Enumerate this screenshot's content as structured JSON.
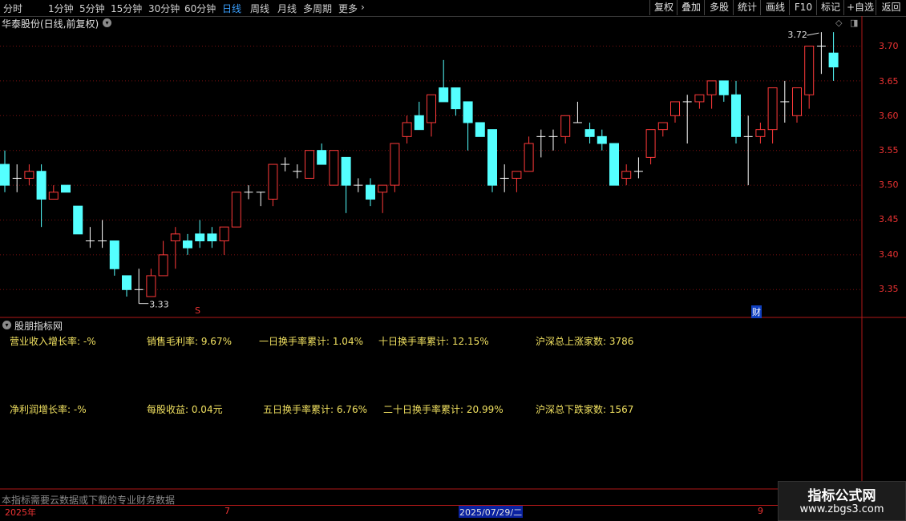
{
  "toolbar": {
    "periods": [
      "分时",
      "1分钟",
      "5分钟",
      "15分钟",
      "30分钟",
      "60分钟",
      "日线",
      "周线",
      "月线",
      "多周期",
      "更多"
    ],
    "active_period": "日线",
    "more_arrow": "›",
    "buttons": [
      "复权",
      "叠加",
      "多股",
      "统计",
      "画线",
      "F10",
      "标记",
      "+自选",
      "返回"
    ]
  },
  "chart": {
    "title": "华泰股份(日线,前复权)",
    "price_labels": [
      "3.70",
      "3.65",
      "3.60",
      "3.55",
      "3.50",
      "3.45",
      "3.40",
      "3.35"
    ],
    "high_annotation": "3.72",
    "low_annotation": "3.33",
    "marker_s": "S",
    "marker_cai": "财",
    "colors": {
      "up": "#ff3a3a",
      "down": "#54ffff",
      "grid": "#7a1010",
      "text": "#e33"
    }
  },
  "chart_data": {
    "type": "candlestick",
    "ylim": [
      3.31,
      3.73
    ],
    "ohlc": [
      [
        3.53,
        3.55,
        3.49,
        3.5
      ],
      [
        3.51,
        3.53,
        3.49,
        3.51
      ],
      [
        3.51,
        3.53,
        3.5,
        3.52
      ],
      [
        3.52,
        3.53,
        3.44,
        3.48
      ],
      [
        3.48,
        3.5,
        3.48,
        3.49
      ],
      [
        3.5,
        3.5,
        3.49,
        3.49
      ],
      [
        3.47,
        3.47,
        3.43,
        3.43
      ],
      [
        3.42,
        3.44,
        3.41,
        3.42
      ],
      [
        3.42,
        3.45,
        3.41,
        3.42
      ],
      [
        3.42,
        3.42,
        3.37,
        3.38
      ],
      [
        3.37,
        3.37,
        3.34,
        3.35
      ],
      [
        3.35,
        3.38,
        3.33,
        3.35
      ],
      [
        3.34,
        3.38,
        3.34,
        3.37
      ],
      [
        3.37,
        3.42,
        3.37,
        3.4
      ],
      [
        3.42,
        3.44,
        3.38,
        3.43
      ],
      [
        3.42,
        3.43,
        3.4,
        3.41
      ],
      [
        3.43,
        3.45,
        3.41,
        3.42
      ],
      [
        3.43,
        3.44,
        3.41,
        3.42
      ],
      [
        3.42,
        3.44,
        3.4,
        3.44
      ],
      [
        3.44,
        3.49,
        3.44,
        3.49
      ],
      [
        3.49,
        3.5,
        3.48,
        3.49
      ],
      [
        3.49,
        3.49,
        3.47,
        3.49
      ],
      [
        3.48,
        3.53,
        3.47,
        3.53
      ],
      [
        3.53,
        3.54,
        3.52,
        3.53
      ],
      [
        3.52,
        3.53,
        3.51,
        3.52
      ],
      [
        3.51,
        3.55,
        3.51,
        3.55
      ],
      [
        3.55,
        3.56,
        3.53,
        3.53
      ],
      [
        3.5,
        3.55,
        3.5,
        3.55
      ],
      [
        3.54,
        3.54,
        3.46,
        3.5
      ],
      [
        3.5,
        3.51,
        3.49,
        3.5
      ],
      [
        3.5,
        3.51,
        3.47,
        3.48
      ],
      [
        3.49,
        3.5,
        3.46,
        3.5
      ],
      [
        3.5,
        3.56,
        3.49,
        3.56
      ],
      [
        3.57,
        3.6,
        3.56,
        3.59
      ],
      [
        3.6,
        3.62,
        3.58,
        3.58
      ],
      [
        3.59,
        3.63,
        3.57,
        3.63
      ],
      [
        3.64,
        3.68,
        3.62,
        3.62
      ],
      [
        3.64,
        3.64,
        3.6,
        3.61
      ],
      [
        3.62,
        3.62,
        3.55,
        3.59
      ],
      [
        3.59,
        3.59,
        3.57,
        3.57
      ],
      [
        3.58,
        3.58,
        3.49,
        3.5
      ],
      [
        3.51,
        3.53,
        3.49,
        3.51
      ],
      [
        3.51,
        3.52,
        3.49,
        3.52
      ],
      [
        3.52,
        3.57,
        3.52,
        3.56
      ],
      [
        3.57,
        3.58,
        3.54,
        3.57
      ],
      [
        3.57,
        3.58,
        3.55,
        3.57
      ],
      [
        3.57,
        3.6,
        3.56,
        3.6
      ],
      [
        3.59,
        3.62,
        3.59,
        3.59
      ],
      [
        3.58,
        3.59,
        3.56,
        3.57
      ],
      [
        3.57,
        3.58,
        3.55,
        3.56
      ],
      [
        3.56,
        3.56,
        3.5,
        3.5
      ],
      [
        3.51,
        3.53,
        3.5,
        3.52
      ],
      [
        3.52,
        3.54,
        3.51,
        3.52
      ],
      [
        3.54,
        3.58,
        3.53,
        3.58
      ],
      [
        3.58,
        3.59,
        3.57,
        3.59
      ],
      [
        3.6,
        3.62,
        3.59,
        3.62
      ],
      [
        3.62,
        3.63,
        3.56,
        3.62
      ],
      [
        3.62,
        3.63,
        3.61,
        3.63
      ],
      [
        3.63,
        3.65,
        3.61,
        3.65
      ],
      [
        3.65,
        3.65,
        3.62,
        3.63
      ],
      [
        3.63,
        3.65,
        3.56,
        3.57
      ],
      [
        3.57,
        3.6,
        3.5,
        3.57
      ],
      [
        3.57,
        3.59,
        3.56,
        3.58
      ],
      [
        3.58,
        3.64,
        3.56,
        3.64
      ],
      [
        3.62,
        3.65,
        3.59,
        3.62
      ],
      [
        3.6,
        3.64,
        3.59,
        3.64
      ],
      [
        3.63,
        3.7,
        3.61,
        3.7
      ],
      [
        3.7,
        3.72,
        3.66,
        3.7
      ],
      [
        3.69,
        3.72,
        3.65,
        3.67
      ]
    ]
  },
  "indicators": {
    "panel_title": "股朋指标网",
    "items": [
      "营业收入增长率: -%",
      "销售毛利率: 9.67%",
      "一日换手率累计: 1.04%",
      "十日换手率累计: 12.15%",
      "沪深总上涨家数: 3786",
      "净利润增长率: -%",
      "每股收益: 0.04元",
      "五日换手率累计: 6.76%",
      "二十日换手率累计: 20.99%",
      "沪深总下跌家数: 1567"
    ]
  },
  "footer_note": "本指标需要云数据或下载的专业财务数据",
  "timebar": {
    "year": "2025年",
    "m7": "7",
    "selected_date": "2025/07/29/二",
    "m9": "9"
  },
  "watermark": {
    "title": "指标公式网",
    "url": "www.zbgs3.com"
  }
}
